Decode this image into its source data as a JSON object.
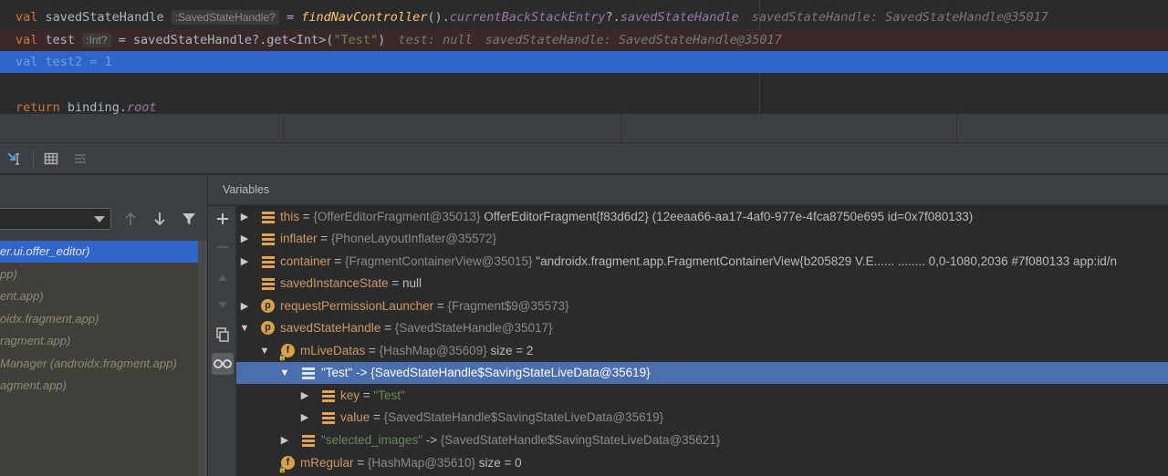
{
  "editor": {
    "line1": {
      "kw": "val",
      "name": "savedStateHandle",
      "type_hint": ":SavedStateHandle?",
      "eq": " = ",
      "fn": "findNavController",
      "parens": "().",
      "prop1": "currentBackStackEntry",
      "safe": "?.",
      "prop2": "savedStateHandle",
      "inline": "savedStateHandle: SavedStateHandle@35017"
    },
    "line2": {
      "kw": "val",
      "name": "test",
      "type_hint": ":Int?",
      "code": " = savedStateHandle?.get<Int>(",
      "arg": "\"Test\"",
      "close": ")",
      "inline1": "test: null",
      "inline2": "savedStateHandle: SavedStateHandle@35017"
    },
    "line3": {
      "kw": "val",
      "name": "test2",
      "eq": " = ",
      "num": "1"
    },
    "line5": {
      "kw": "return",
      "obj": "binding",
      "dot": ".",
      "prop": "root"
    }
  },
  "toolbar": {
    "icons": [
      "step-out-cursor-icon",
      "evaluate-table-icon",
      "trace-stream-icon"
    ]
  },
  "frames": {
    "items": [
      {
        "label": "er.ui.offer_editor)",
        "selected": true
      },
      {
        "label": "pp)",
        "selected": false
      },
      {
        "label": "ent.app)",
        "selected": false
      },
      {
        "label": "oidx.fragment.app)",
        "selected": false
      },
      {
        "label": "ragment.app)",
        "selected": false
      },
      {
        "label": "Manager (androidx.fragment.app)",
        "selected": false
      },
      {
        "label": "agment.app)",
        "selected": false
      }
    ]
  },
  "variables": {
    "title": "Variables",
    "rows": [
      {
        "name": "this",
        "eq": " = ",
        "ref": "{OfferEditorFragment@35013}",
        "value": " OfferEditorFragment{f83d6d2} (12eeaa66-aa17-4af0-977e-4fca8750e695 id=0x7f080133)"
      },
      {
        "name": "inflater",
        "eq": " = ",
        "ref": "{PhoneLayoutInflater@35572}",
        "value": ""
      },
      {
        "name": "container",
        "eq": " = ",
        "ref": "{FragmentContainerView@35015}",
        "value": " \"androidx.fragment.app.FragmentContainerView{b205829 V.E...... ........ 0,0-1080,2036 #7f080133 app:id/n"
      },
      {
        "name": "savedInstanceState",
        "eq": " = ",
        "ref": "",
        "value": "null"
      },
      {
        "name": "requestPermissionLauncher",
        "eq": " = ",
        "ref": "{Fragment$9@35573}",
        "value": ""
      },
      {
        "name": "savedStateHandle",
        "eq": " = ",
        "ref": "{SavedStateHandle@35017}",
        "value": ""
      },
      {
        "name": "mLiveDatas",
        "eq": " = ",
        "ref": "{HashMap@35609}",
        "value": "  size = 2"
      },
      {
        "name": "\"Test\"",
        "eq": " -> ",
        "ref": "{SavedStateHandle$SavingStateLiveData@35619}",
        "value": ""
      },
      {
        "name": "key",
        "eq": " = ",
        "ref": "",
        "value": "\"Test\""
      },
      {
        "name": "value",
        "eq": " = ",
        "ref": "{SavedStateHandle$SavingStateLiveData@35619}",
        "value": ""
      },
      {
        "name": "\"selected_images\"",
        "eq": " -> ",
        "ref": "{SavedStateHandle$SavingStateLiveData@35621}",
        "value": ""
      },
      {
        "name": "mRegular",
        "eq": " = ",
        "ref": "{HashMap@35610}",
        "value": "  size = 0"
      }
    ]
  },
  "colors": {
    "editor_bg": "#2b2b2b",
    "execution_line": "#2f65ca",
    "breakpoint_line": "#3b2929",
    "selection": "#4b6eaf",
    "keyword": "#cc7832",
    "string": "#6a8759"
  }
}
